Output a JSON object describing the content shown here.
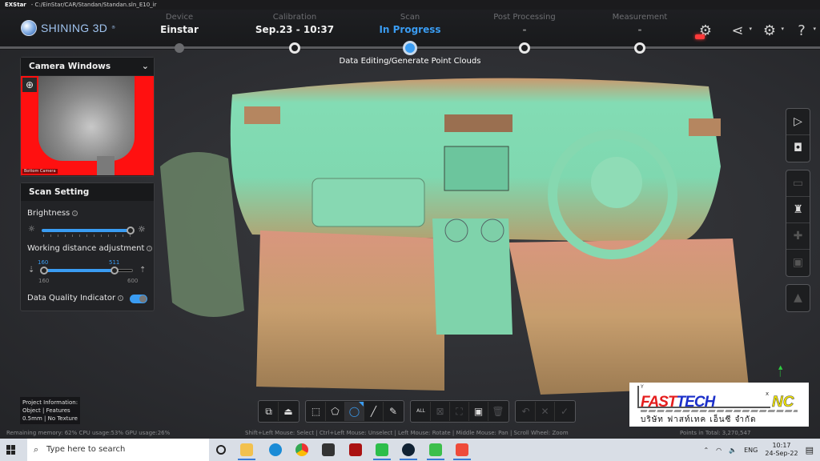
{
  "window": {
    "app_name": "EXStar",
    "path": "C:/EinStar/CAR/Standan/Standan.sln_E10_ir"
  },
  "header": {
    "brand": "SHINING 3D",
    "steps": [
      {
        "label": "Device",
        "value": "Einstar",
        "state": "done"
      },
      {
        "label": "Calibration",
        "value": "Sep.23 - 10:37",
        "state": "done"
      },
      {
        "label": "Scan",
        "value": "In Progress",
        "state": "active"
      },
      {
        "label": "Post Processing",
        "value": "-",
        "state": "pending"
      },
      {
        "label": "Measurement",
        "value": "-",
        "state": "pending"
      }
    ],
    "substep": "Data Editing/Generate Point Clouds",
    "icons": [
      "record-device-icon",
      "share-icon",
      "settings-icon",
      "help-icon"
    ]
  },
  "camera_panel": {
    "title": "Camera Windows",
    "caption": "Bottom Camera"
  },
  "scan_setting": {
    "title": "Scan Setting",
    "brightness_label": "Brightness",
    "brightness_value_fraction": 0.98,
    "working_distance_label": "Working distance adjustment",
    "wd_low_value": "160",
    "wd_high_value": "511",
    "wd_min": "160",
    "wd_max": "600",
    "data_quality_label": "Data Quality Indicator",
    "data_quality_on": true
  },
  "right_toolbar": {
    "groups": [
      [
        "scan-mode-icon",
        "camera-view-icon"
      ],
      [
        "window-icon",
        "brush-clean-icon",
        "puzzle-icon",
        "save-icon"
      ],
      [
        "point-quality-icon"
      ]
    ]
  },
  "bottom_toolbar": {
    "groups": [
      [
        "view-cube-icon",
        "scan-plane-icon"
      ],
      [
        "rect-select-icon",
        "polygon-select-icon",
        "lasso-select-icon",
        "line-select-icon",
        "brush-select-icon"
      ],
      [
        "select-all-icon",
        "deselect-icon",
        "invert-select-icon",
        "select-connected-icon",
        "delete-icon"
      ],
      [
        "undo-icon",
        "cancel-icon",
        "confirm-icon"
      ]
    ],
    "select_all_label": "ALL"
  },
  "project_info": {
    "line1": "Project Information:",
    "line2": "Object | Features",
    "line3": "0.5mm | No Texture"
  },
  "status": {
    "resources": "Remaining memory: 62% CPU usage:53%  GPU usage:26%",
    "hint": "Shift+Left Mouse: Select | Ctrl+Left Mouse: Unselect | Left Mouse: Rotate | Middle Mouse: Pan | Scroll Wheel: Zoom",
    "points": "Points in Total: 3,270,547"
  },
  "watermark": {
    "part1": "FAST",
    "part2": "TECH",
    "part3": "NC",
    "thai": "บริษัท  ฟาสท์เทค  เอ็นซี  จำกัด",
    "axis_x": "x",
    "axis_y": "Y"
  },
  "taskbar": {
    "search_placeholder": "Type here to search",
    "apps": [
      "task-view",
      "file-explorer",
      "edge",
      "chrome",
      "store",
      "red-app",
      "line",
      "exstar",
      "camtasia-green",
      "camtasia-red"
    ],
    "tray_lang": "ENG",
    "time": "10:17",
    "date": "24-Sep-22"
  }
}
